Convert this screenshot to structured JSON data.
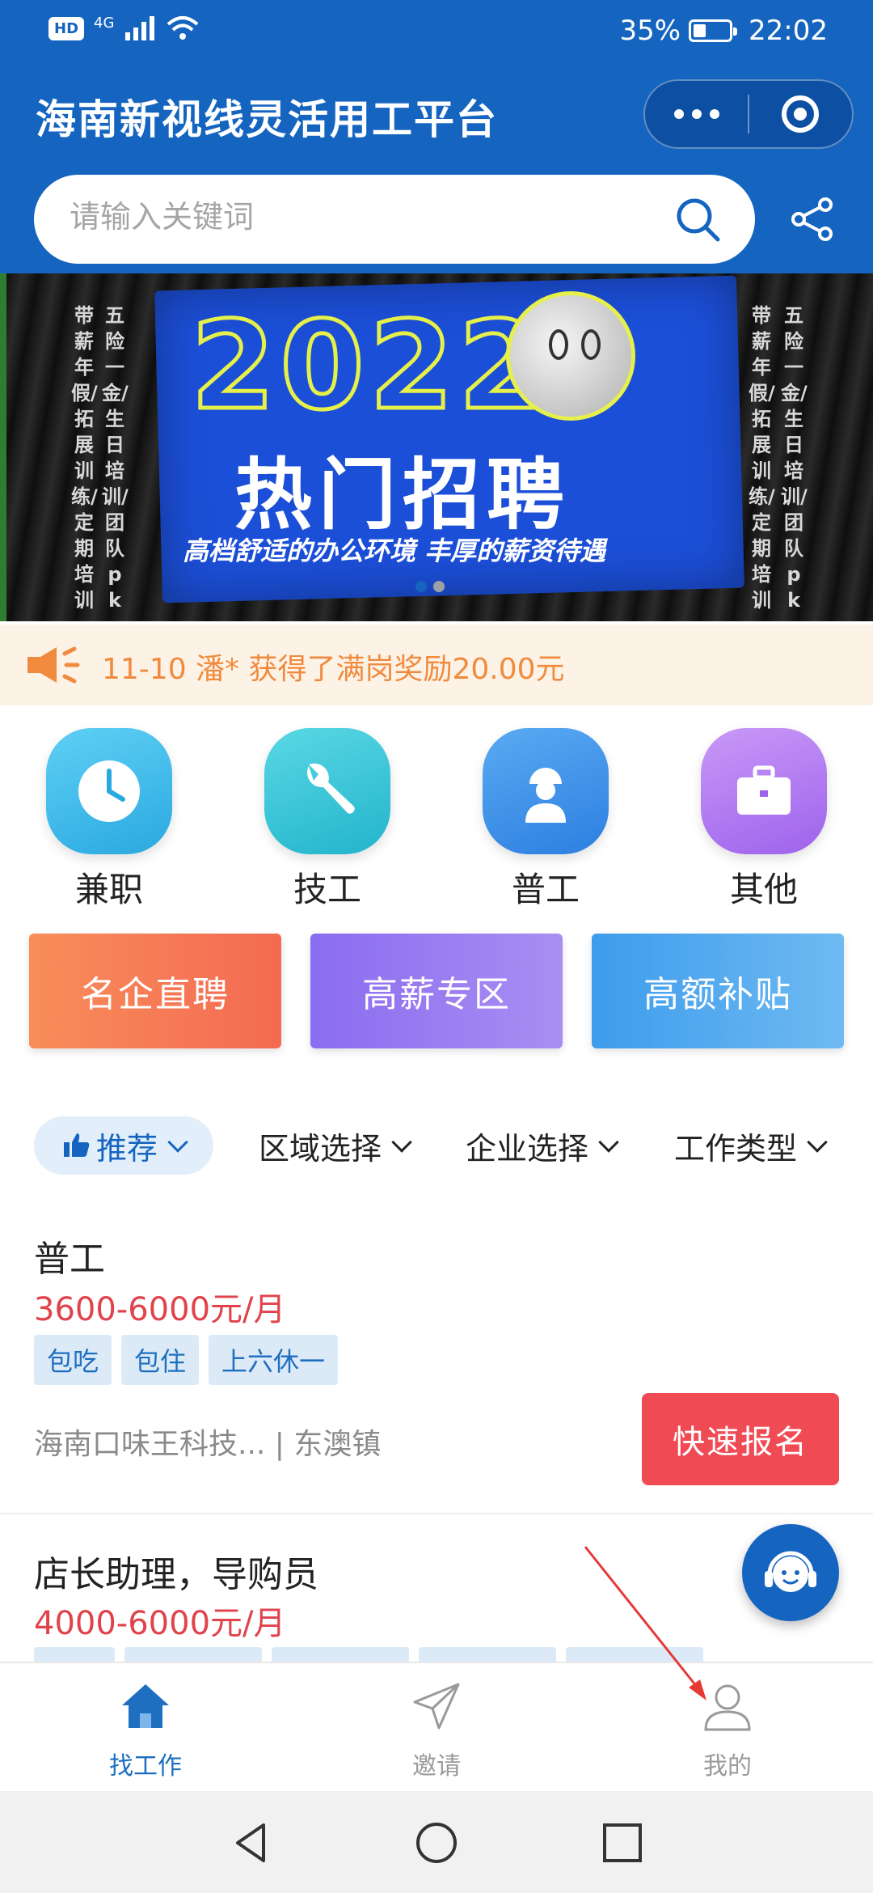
{
  "status_bar": {
    "network": "4G",
    "hd": "HD",
    "battery": "35%",
    "battery_level": 0.35,
    "time": "22:02"
  },
  "header": {
    "title": "海南新视线灵活用工平台",
    "search_placeholder": "请输入关键词"
  },
  "banner": {
    "year": "2022",
    "headline": "热门招聘",
    "slogan": "高档舒适的办公环境 丰厚的薪资待遇",
    "left_text_a": "带薪年假/拓展训练/定期培训",
    "left_text_b": "五险一金/生日培训/团队pk",
    "right_text_a": "带薪年假/拓展训练/定期培训",
    "right_text_b": "五险一金/生日培训/团队pk",
    "slides": 2,
    "active_slide": 1
  },
  "notice": {
    "text": "11-10 潘* 获得了满岗奖励20.00元"
  },
  "categories": [
    {
      "label": "兼职",
      "icon": "clock-icon",
      "color": "#3fb8ea"
    },
    {
      "label": "技工",
      "icon": "wrench-icon",
      "color": "#33c4d6"
    },
    {
      "label": "普工",
      "icon": "worker-icon",
      "color": "#3a8fe8"
    },
    {
      "label": "其他",
      "icon": "briefcase-icon",
      "color": "#b37ef0"
    }
  ],
  "promos": [
    {
      "label": "名企直聘",
      "color": "#f7825e"
    },
    {
      "label": "高薪专区",
      "color": "#8f7cf0"
    },
    {
      "label": "高额补贴",
      "color": "#4ea8ee"
    }
  ],
  "filters": {
    "recommend": "推荐",
    "area": "区域选择",
    "company": "企业选择",
    "job_type": "工作类型"
  },
  "jobs": [
    {
      "title": "普工",
      "salary": "3600-6000元/月",
      "tags": [
        "包吃",
        "包住",
        "上六休一"
      ],
      "company": "海南口味王科技... | 东澳镇",
      "apply_label": "快速报名"
    },
    {
      "title": "店长助理，导购员",
      "salary": "4000-6000元/月"
    }
  ],
  "tabbar": {
    "tabs": [
      {
        "label": "找工作",
        "icon": "home-icon",
        "active": true
      },
      {
        "label": "邀请",
        "icon": "send-icon",
        "active": false
      },
      {
        "label": "我的",
        "icon": "user-icon",
        "active": false
      }
    ]
  },
  "colors": {
    "brand": "#1565c0",
    "salary": "#e0434b",
    "apply": "#f04b55",
    "notice": "#f08b3e"
  }
}
